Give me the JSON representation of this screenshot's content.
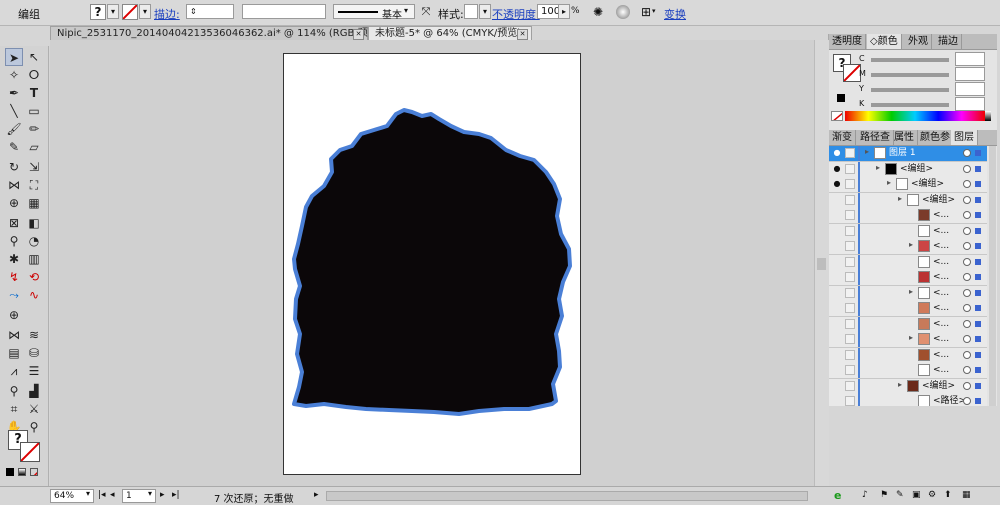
{
  "control_bar": {
    "object_type": "编组",
    "stroke_label": "描边:",
    "stroke_profile": "基本",
    "style_label": "样式:",
    "opacity_label": "不透明度:",
    "opacity_value": "100",
    "opacity_unit": "%",
    "transform_label": "变换"
  },
  "doc_tabs": [
    {
      "label": "Nipic_2531170_20140404213536046362.ai* @ 114% (RGB/预览)",
      "active": false
    },
    {
      "label": "未标题-5* @ 64% (CMYK/预览)",
      "active": true
    }
  ],
  "color_panel": {
    "tabs": [
      "透明度",
      "颜色",
      "外观",
      "描边"
    ],
    "active_tab": "颜色",
    "sliders": [
      {
        "label": "C",
        "value": ""
      },
      {
        "label": "M",
        "value": ""
      },
      {
        "label": "Y",
        "value": ""
      },
      {
        "label": "K",
        "value": ""
      }
    ]
  },
  "layers_panel": {
    "tabs": [
      "渐变",
      "路径查",
      "属性",
      "颜色参",
      "图层"
    ],
    "active_tab": "图层",
    "rows": [
      {
        "name": "图层 1",
        "indent": 0,
        "highlight": true
      },
      {
        "name": "<编组>",
        "indent": 1,
        "highlight": false
      },
      {
        "name": "<编组>",
        "indent": 2,
        "highlight": false
      },
      {
        "name": "<编组>",
        "indent": 3,
        "highlight": false
      },
      {
        "name": "<...",
        "indent": 4,
        "highlight": false
      },
      {
        "name": "<...",
        "indent": 4,
        "highlight": false
      },
      {
        "name": "<...",
        "indent": 4,
        "highlight": false
      },
      {
        "name": "<...",
        "indent": 4,
        "highlight": false
      },
      {
        "name": "<...",
        "indent": 4,
        "highlight": false
      },
      {
        "name": "<...",
        "indent": 4,
        "highlight": false
      },
      {
        "name": "<...",
        "indent": 4,
        "highlight": false
      },
      {
        "name": "<...",
        "indent": 4,
        "highlight": false
      },
      {
        "name": "<...",
        "indent": 4,
        "highlight": false
      },
      {
        "name": "<...",
        "indent": 4,
        "highlight": false
      },
      {
        "name": "<...",
        "indent": 4,
        "highlight": false
      },
      {
        "name": "<编组>",
        "indent": 3,
        "highlight": false
      },
      {
        "name": "<路径>",
        "indent": 4,
        "highlight": false
      }
    ]
  },
  "status_bar": {
    "zoom": "64%",
    "artboard": "1",
    "history": "7 次还原；无重做"
  },
  "colors": {
    "accent": "#2f8ee6",
    "selection_outline": "#4a7fd6",
    "fill": "#0b0709"
  }
}
